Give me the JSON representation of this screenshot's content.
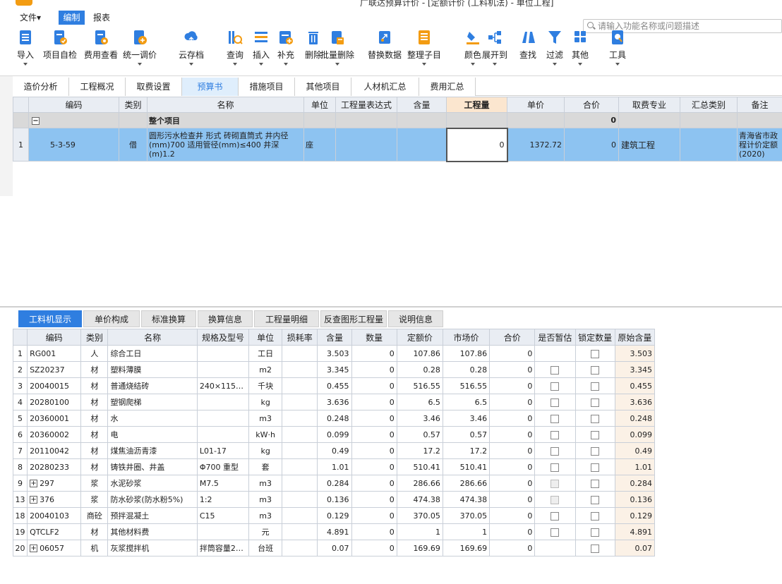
{
  "window": {
    "title": "广联达预算计价 - [定额计价 (工料机法) - 单位工程]"
  },
  "menu": {
    "file": "文件▾",
    "edit": "编制",
    "report": "报表"
  },
  "search": {
    "placeholder": "请输入功能名称或问题描述"
  },
  "toolbar": [
    {
      "label": "导入",
      "icon": "import-icon",
      "dropdown": true
    },
    {
      "label": "项目自检",
      "icon": "check-icon",
      "dropdown": false
    },
    {
      "label": "费用查看",
      "icon": "fee-view-icon",
      "dropdown": false
    },
    {
      "label": "统一调价",
      "icon": "price-adjust-icon",
      "dropdown": true
    },
    {
      "label": "云存档",
      "icon": "cloud-icon",
      "dropdown": true
    },
    {
      "label": "查询",
      "icon": "query-icon",
      "dropdown": true
    },
    {
      "label": "插入",
      "icon": "insert-icon",
      "dropdown": true
    },
    {
      "label": "补充",
      "icon": "supplement-icon",
      "dropdown": true
    },
    {
      "label": "删除",
      "icon": "delete-icon",
      "dropdown": false
    },
    {
      "label": "批量删除",
      "icon": "batch-delete-icon",
      "dropdown": true
    },
    {
      "label": "替换数据",
      "icon": "replace-icon",
      "dropdown": false
    },
    {
      "label": "整理子目",
      "icon": "organize-icon",
      "dropdown": true
    },
    {
      "label": "颜色",
      "icon": "color-icon",
      "dropdown": true
    },
    {
      "label": "展开到",
      "icon": "expand-icon",
      "dropdown": true
    },
    {
      "label": "查找",
      "icon": "find-icon",
      "dropdown": false
    },
    {
      "label": "过滤",
      "icon": "filter-icon",
      "dropdown": true
    },
    {
      "label": "其他",
      "icon": "other-icon",
      "dropdown": true
    },
    {
      "label": "工具",
      "icon": "tools-icon",
      "dropdown": true
    }
  ],
  "main_tabs": [
    "造价分析",
    "工程概况",
    "取费设置",
    "预算书",
    "措施项目",
    "其他项目",
    "人材机汇总",
    "费用汇总"
  ],
  "main_tab_active": "预算书",
  "grid1": {
    "headers": [
      "编码",
      "类别",
      "名称",
      "单位",
      "工程量表达式",
      "含量",
      "工程量",
      "单价",
      "合价",
      "取费专业",
      "汇总类别",
      "备注"
    ],
    "group_row": {
      "toggle": "−",
      "name": "整个项目",
      "total": "0"
    },
    "row": {
      "index": "1",
      "code": "5-3-59",
      "type": "借",
      "name": "圆形污水检查井 形式 砖砌直筒式 井内径(mm)700 适用管径(mm)≤400 井深(m)1.2",
      "unit": "座",
      "quantity": "0",
      "unit_price": "1372.72",
      "total": "0",
      "fee_category": "建筑工程",
      "remark": "青海省市政程计价定额(2020)"
    }
  },
  "detail_tabs": [
    "工料机显示",
    "单价构成",
    "标准换算",
    "换算信息",
    "工程量明细",
    "反查图形工程量",
    "说明信息"
  ],
  "detail_tab_active": "工料机显示",
  "grid2": {
    "headers": [
      "编码",
      "类别",
      "名称",
      "规格及型号",
      "单位",
      "损耗率",
      "含量",
      "数量",
      "定额价",
      "市场价",
      "合价",
      "是否暂估",
      "锁定数量",
      "原始含量"
    ],
    "rows": [
      {
        "idx": "1",
        "expand": false,
        "code": "RG001",
        "type": "人",
        "name": "综合工日",
        "spec": "",
        "unit": "工日",
        "loss": "",
        "content": "3.503",
        "qty": "0",
        "quota": "107.86",
        "market": "107.86",
        "total": "0",
        "est": "none",
        "lock": "box",
        "orig": "3.503"
      },
      {
        "idx": "2",
        "expand": false,
        "code": "SZ20237",
        "type": "材",
        "name": "塑料薄膜",
        "spec": "",
        "unit": "m2",
        "loss": "",
        "content": "3.345",
        "qty": "0",
        "quota": "0.28",
        "market": "0.28",
        "total": "0",
        "est": "box",
        "lock": "box",
        "orig": "3.345"
      },
      {
        "idx": "3",
        "expand": false,
        "code": "20040015",
        "type": "材",
        "name": "普通烧结砖",
        "spec": "240×115…",
        "unit": "千块",
        "loss": "",
        "content": "0.455",
        "qty": "0",
        "quota": "516.55",
        "market": "516.55",
        "total": "0",
        "est": "box",
        "lock": "box",
        "orig": "0.455"
      },
      {
        "idx": "4",
        "expand": false,
        "code": "20280100",
        "type": "材",
        "name": "塑钢爬梯",
        "spec": "",
        "unit": "kg",
        "loss": "",
        "content": "3.636",
        "qty": "0",
        "quota": "6.5",
        "market": "6.5",
        "total": "0",
        "est": "box",
        "lock": "box",
        "orig": "3.636"
      },
      {
        "idx": "5",
        "expand": false,
        "code": "20360001",
        "type": "材",
        "name": "水",
        "spec": "",
        "unit": "m3",
        "loss": "",
        "content": "0.248",
        "qty": "0",
        "quota": "3.46",
        "market": "3.46",
        "total": "0",
        "est": "box",
        "lock": "box",
        "orig": "0.248"
      },
      {
        "idx": "6",
        "expand": false,
        "code": "20360002",
        "type": "材",
        "name": "电",
        "spec": "",
        "unit": "kW·h",
        "loss": "",
        "content": "0.099",
        "qty": "0",
        "quota": "0.57",
        "market": "0.57",
        "total": "0",
        "est": "box",
        "lock": "box",
        "orig": "0.099"
      },
      {
        "idx": "7",
        "expand": false,
        "code": "20110042",
        "type": "材",
        "name": "煤焦油沥青漆",
        "spec": "L01-17",
        "unit": "kg",
        "loss": "",
        "content": "0.49",
        "qty": "0",
        "quota": "17.2",
        "market": "17.2",
        "total": "0",
        "est": "box",
        "lock": "box",
        "orig": "0.49"
      },
      {
        "idx": "8",
        "expand": false,
        "code": "20280233",
        "type": "材",
        "name": "铸铁井圈、井盖",
        "spec": "Φ700 重型",
        "unit": "套",
        "loss": "",
        "content": "1.01",
        "qty": "0",
        "quota": "510.41",
        "market": "510.41",
        "total": "0",
        "est": "box",
        "lock": "box",
        "orig": "1.01"
      },
      {
        "idx": "9",
        "expand": true,
        "code": "297",
        "type": "浆",
        "name": "水泥砂浆",
        "spec": "M7.5",
        "unit": "m3",
        "loss": "",
        "content": "0.284",
        "qty": "0",
        "quota": "286.66",
        "market": "286.66",
        "total": "0",
        "est": "dis",
        "lock": "box",
        "orig": "0.284"
      },
      {
        "idx": "13",
        "expand": true,
        "code": "376",
        "type": "浆",
        "name": "防水砂浆(防水粉5%)",
        "spec": "1:2",
        "unit": "m3",
        "loss": "",
        "content": "0.136",
        "qty": "0",
        "quota": "474.38",
        "market": "474.38",
        "total": "0",
        "est": "dis",
        "lock": "box",
        "orig": "0.136"
      },
      {
        "idx": "18",
        "expand": false,
        "code": "20040103",
        "type": "商砼",
        "name": "预拌混凝土",
        "spec": "C15",
        "unit": "m3",
        "loss": "",
        "content": "0.129",
        "qty": "0",
        "quota": "370.05",
        "market": "370.05",
        "total": "0",
        "est": "box",
        "lock": "box",
        "orig": "0.129"
      },
      {
        "idx": "19",
        "expand": false,
        "code": "QTCLF2",
        "type": "材",
        "name": "其他材料费",
        "spec": "",
        "unit": "元",
        "loss": "",
        "content": "4.891",
        "qty": "0",
        "quota": "1",
        "market": "1",
        "total": "0",
        "est": "box",
        "lock": "box",
        "orig": "4.891"
      },
      {
        "idx": "20",
        "expand": true,
        "code": "06057",
        "type": "机",
        "name": "灰浆搅拌机",
        "spec": "拌筒容量2…",
        "unit": "台班",
        "loss": "",
        "content": "0.07",
        "qty": "0",
        "quota": "169.69",
        "market": "169.69",
        "total": "0",
        "est": "none",
        "lock": "box",
        "orig": "0.07"
      }
    ]
  },
  "colors": {
    "accent": "#2f7ee0",
    "selected_row": "#8dc3f1",
    "group_row": "#d9d9d9",
    "header_bg": "#e9edf3",
    "highlight_header": "#fbe6cf",
    "orig_col": "#fbf1e6"
  }
}
